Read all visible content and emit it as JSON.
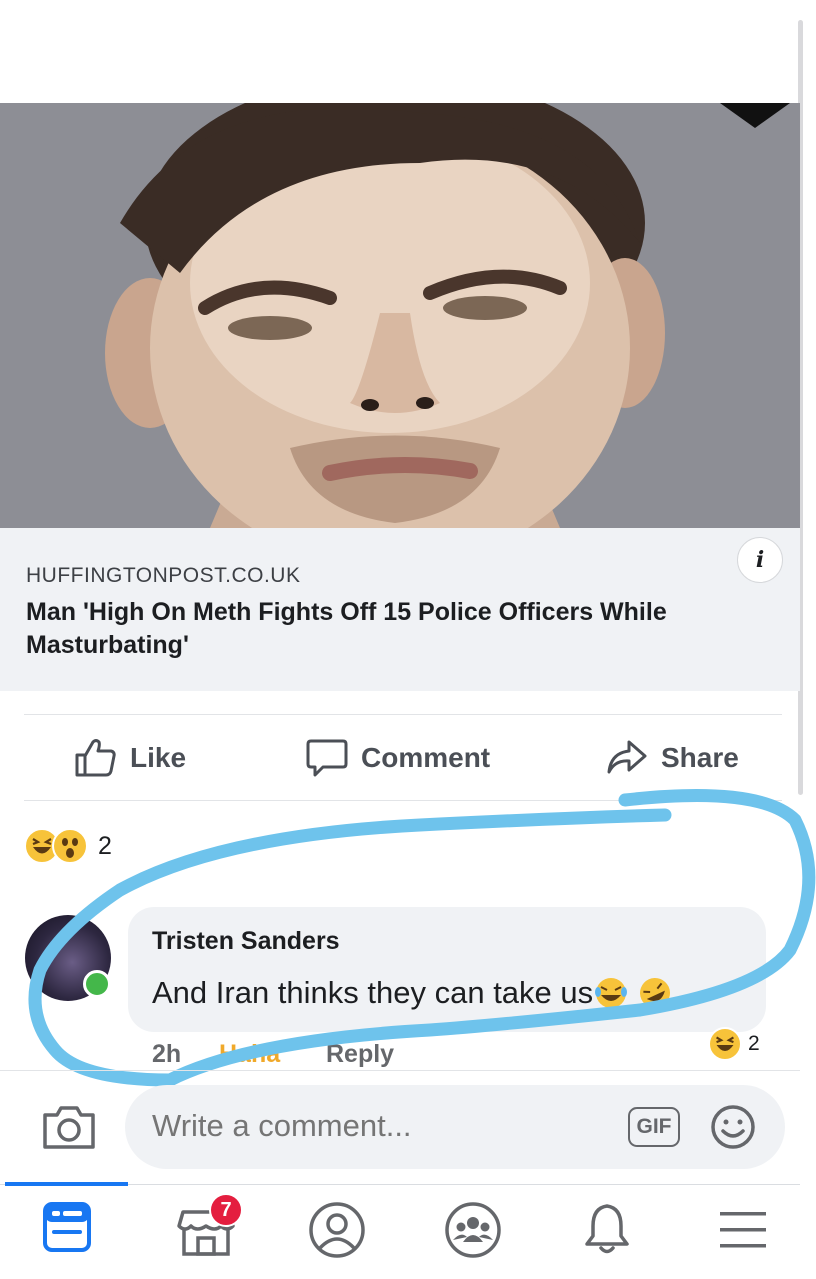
{
  "link_preview": {
    "domain": "HUFFINGTONPOST.CO.UK",
    "title": "Man 'High On Meth Fights Off 15 Police Officers While Masturbating'",
    "info_icon": "i"
  },
  "actions": {
    "like_label": "Like",
    "comment_label": "Comment",
    "share_label": "Share"
  },
  "post_reactions": {
    "types": [
      "haha",
      "wow"
    ],
    "count": "2"
  },
  "comment": {
    "author": "Tristen Sanders",
    "text": "And Iran thinks they can take us",
    "trailing_emojis": [
      "tears-of-joy",
      "rolling-on-floor-laughing"
    ],
    "time": "2h",
    "reaction_label": "Haha",
    "reply_label": "Reply",
    "reaction_count": "2",
    "author_online": true
  },
  "composer": {
    "placeholder": "Write a comment...",
    "gif_label": "GIF"
  },
  "bottom_nav": {
    "items": [
      "news-feed",
      "marketplace",
      "profile",
      "groups",
      "notifications",
      "menu"
    ],
    "active": "news-feed",
    "marketplace_badge": "7"
  },
  "colors": {
    "accent_blue": "#1877f2",
    "highlight_stroke": "#6ec3ec",
    "haha_orange": "#f0a92a",
    "badge_red": "#e41e3f",
    "online_green": "#44b74a"
  }
}
